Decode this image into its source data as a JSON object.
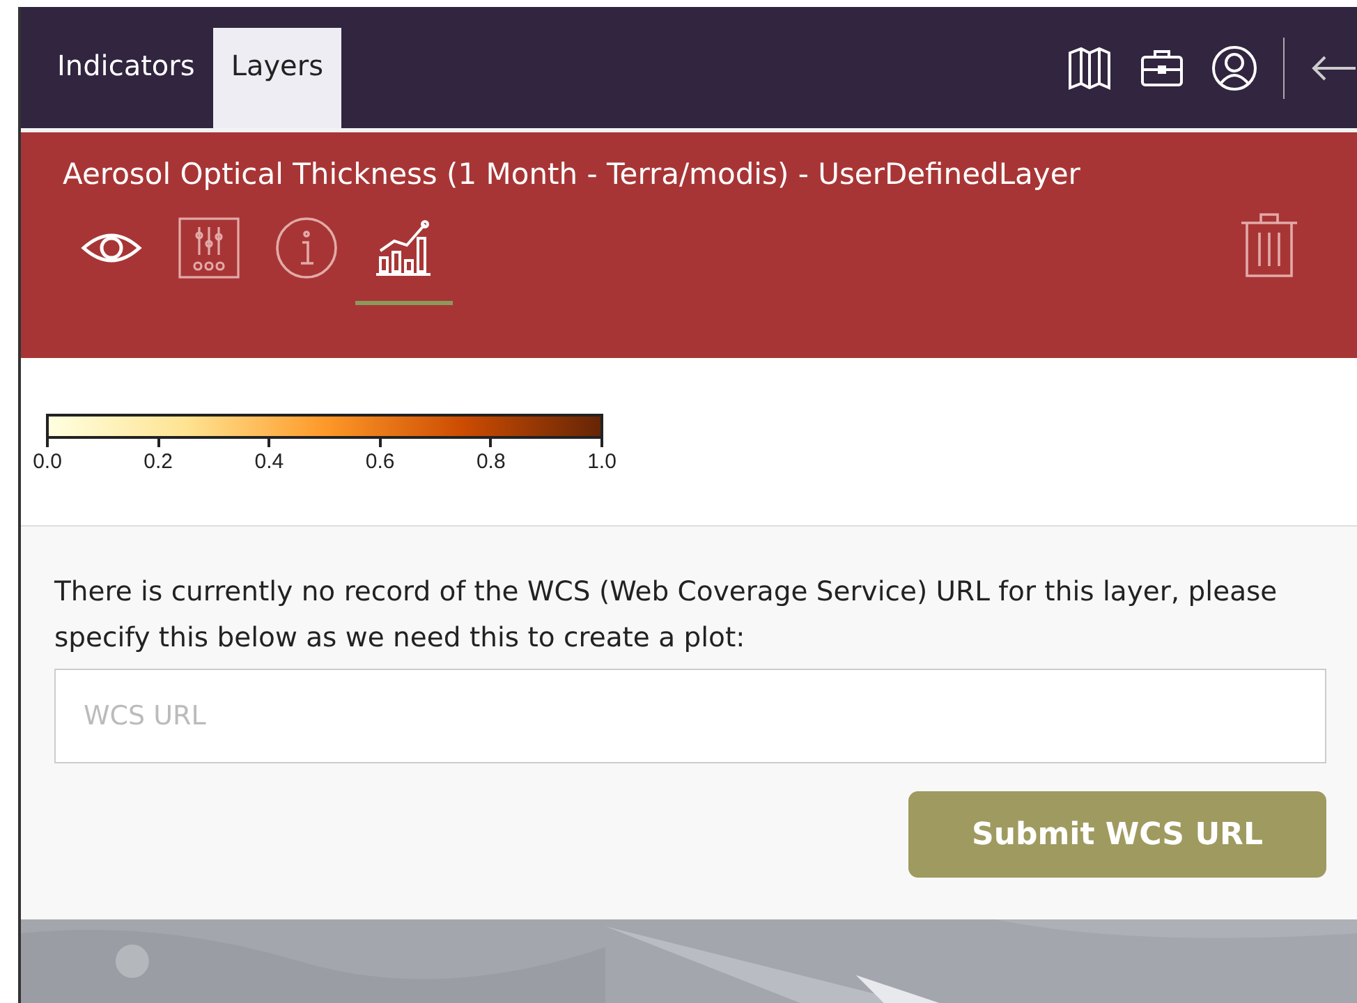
{
  "tabs": [
    {
      "label": "Indicators",
      "selected": false
    },
    {
      "label": "Layers",
      "selected": true
    }
  ],
  "layer": {
    "title": "Aerosol Optical Thickness (1 Month - Terra/modis) - UserDefinedLayer",
    "visible": true,
    "tools": [
      {
        "kind": "visibility",
        "selected": false
      },
      {
        "kind": "settings",
        "selected": false
      },
      {
        "kind": "info",
        "selected": false
      },
      {
        "kind": "plot",
        "selected": true
      }
    ]
  },
  "legend": {
    "ticks": [
      "0.0",
      "0.2",
      "0.4",
      "0.6",
      "0.8",
      "1.0"
    ]
  },
  "wcs": {
    "message": "There is currently no record of the WCS (Web Coverage Service) URL for this layer, please specify this below as we need this to create a plot:",
    "placeholder": "WCS URL",
    "button": "Submit WCS URL"
  }
}
